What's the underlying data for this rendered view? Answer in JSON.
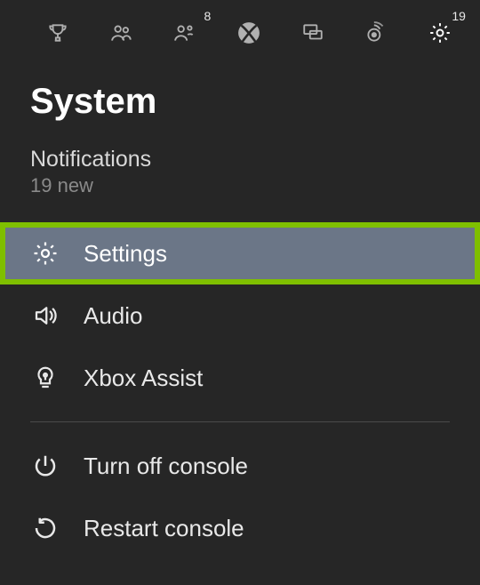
{
  "tabs": {
    "achievements": {
      "name": "achievements-tab"
    },
    "friends": {
      "name": "friends-tab"
    },
    "party": {
      "name": "party-tab",
      "badge": "8"
    },
    "home": {
      "name": "home-tab"
    },
    "chat": {
      "name": "chat-tab"
    },
    "broadcast": {
      "name": "broadcast-tab"
    },
    "system": {
      "name": "system-tab",
      "badge": "19"
    }
  },
  "title": "System",
  "notifications": {
    "label": "Notifications",
    "subtext": "19 new"
  },
  "menu": {
    "settings": {
      "label": "Settings"
    },
    "audio": {
      "label": "Audio"
    },
    "assist": {
      "label": "Xbox Assist"
    },
    "power_off": {
      "label": "Turn off console"
    },
    "restart": {
      "label": "Restart console"
    }
  }
}
